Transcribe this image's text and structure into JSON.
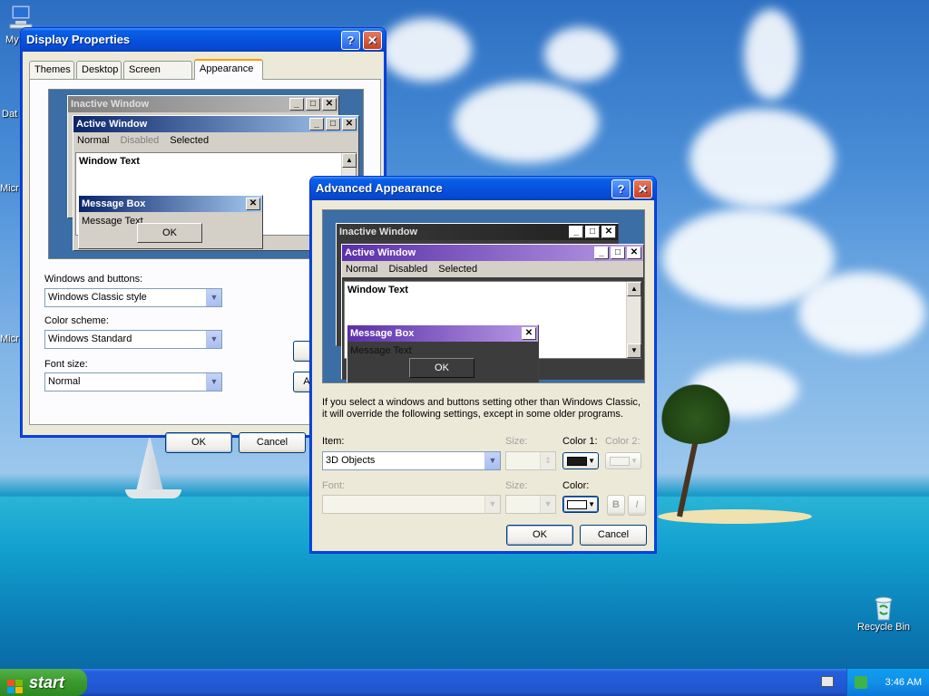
{
  "desktop": {
    "icons": [
      {
        "name": "my-computer",
        "label": "My"
      },
      {
        "name": "data",
        "label": "Dat"
      },
      {
        "name": "micro1",
        "label": "Micr"
      },
      {
        "name": "micro2",
        "label": "Micr"
      },
      {
        "name": "recycle-bin",
        "label": "Recycle Bin"
      }
    ]
  },
  "display_properties": {
    "title": "Display Properties",
    "tabs": [
      "Themes",
      "Desktop",
      "Screen Saver",
      "Appearance"
    ],
    "active_tab": "Appearance",
    "preview": {
      "inactive_title": "Inactive Window",
      "active_title": "Active Window",
      "menu": [
        "Normal",
        "Disabled",
        "Selected"
      ],
      "window_text": "Window Text",
      "msgbox_title": "Message Box",
      "msgbox_text": "Message Text",
      "msgbox_ok": "OK"
    },
    "windows_buttons_label": "Windows and buttons:",
    "windows_buttons_value": "Windows Classic style",
    "color_scheme_label": "Color scheme:",
    "color_scheme_value": "Windows Standard",
    "font_size_label": "Font size:",
    "font_size_value": "Normal",
    "ok": "OK",
    "cancel": "Cancel",
    "partial_button": "A"
  },
  "advanced_appearance": {
    "title": "Advanced Appearance",
    "preview": {
      "inactive_title": "Inactive Window",
      "active_title": "Active Window",
      "menu": [
        "Normal",
        "Disabled",
        "Selected"
      ],
      "window_text": "Window Text",
      "msgbox_title": "Message Box",
      "msgbox_text": "Message Text",
      "msgbox_ok": "OK"
    },
    "info_line1": "If you select a windows and buttons setting other than Windows Classic,",
    "info_line2": "it will override the following settings, except in some older programs.",
    "item_label": "Item:",
    "item_value": "3D Objects",
    "size_label": "Size:",
    "color1_label": "Color 1:",
    "color2_label": "Color 2:",
    "font_label": "Font:",
    "font_size_label": "Size:",
    "color_label": "Color:",
    "bold": "B",
    "italic": "I",
    "ok": "OK",
    "cancel": "Cancel",
    "color1_swatch": "#1a1a1a",
    "color_swatch": "#ffffff"
  },
  "taskbar": {
    "start_label": "start",
    "clock": "3:46 AM"
  },
  "colors": {
    "xp_blue": "#0653dd",
    "inactive_title_dp": "#a8a8a8",
    "active_title_dp": "#3a5fcd",
    "inactive_title_adv": "#303030",
    "active_title_adv": "#6a3fb8",
    "adv_window_bg": "#3c3c3c"
  }
}
